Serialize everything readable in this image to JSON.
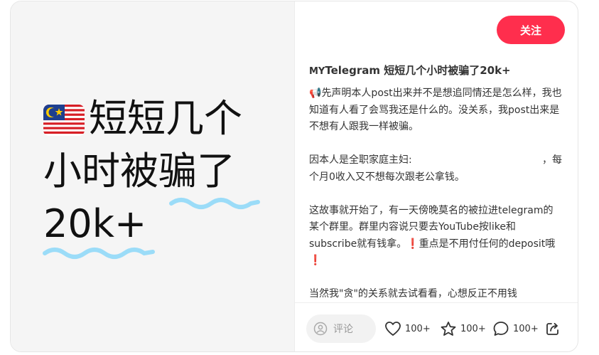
{
  "cover": {
    "line1": "短短几个",
    "line2": "小时被骗了",
    "line3": "20k+"
  },
  "header": {
    "follow_label": "关注"
  },
  "post": {
    "title_prefix": "MY",
    "title_rest": "Telegram 短短几个小时被骗了20k+",
    "paragraphs": {
      "p1_icon": "📢",
      "p1": "先声明本人post出来并不是想追同情还是怎么样，我也知道有人看了会骂我还是什么的。没关系，我post出来是不想有人跟我一样被骗。",
      "p2a": "因本人是全职家庭主妇:",
      "p2b": "，每",
      "p2c": "个月0收入又不想每次跟老公拿钱。",
      "p3a": "这故事就开始了，有一天傍晚莫名的被拉进telegram的某个群里。群里内容说只要去YouTube按like和subscribe就有钱拿。",
      "p3_excl1": "❗",
      "p3b": "重点是不用付任何的deposit哦",
      "p3_excl2": "❗",
      "p4": "当然我\"贪\"的关系就去试看看，心想反正不用钱"
    }
  },
  "actions": {
    "comment_placeholder": "评论",
    "likes": "100+",
    "collects": "100+",
    "comments": "100+",
    "icons": [
      "comment-pen-icon",
      "heart-icon",
      "star-icon",
      "chat-bubble-icon",
      "share-icon"
    ]
  },
  "colors": {
    "accent": "#ff2e4d",
    "squiggle": "#9bdcf8"
  }
}
